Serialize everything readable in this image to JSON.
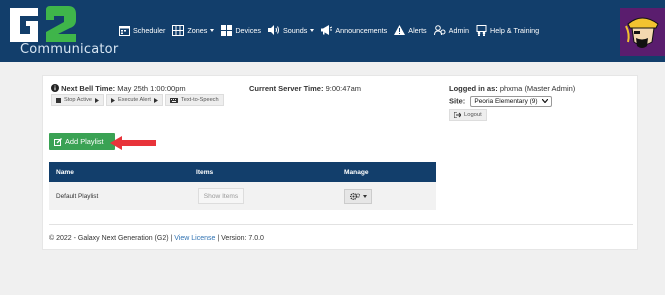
{
  "brand": {
    "logo_text": "G2",
    "subtitle": "Communicator"
  },
  "nav": {
    "items": [
      {
        "label": "Scheduler",
        "icon": "calendar-icon",
        "dropdown": false
      },
      {
        "label": "Zones",
        "icon": "zones-grid-icon",
        "dropdown": true
      },
      {
        "label": "Devices",
        "icon": "devices-grid-icon",
        "dropdown": false
      },
      {
        "label": "Sounds",
        "icon": "speaker-icon",
        "dropdown": true
      },
      {
        "label": "Announcements",
        "icon": "megaphone-icon",
        "dropdown": false
      },
      {
        "label": "Alerts",
        "icon": "warning-icon",
        "dropdown": false
      },
      {
        "label": "Admin",
        "icon": "admin-users-icon",
        "dropdown": false
      },
      {
        "label": "Help & Training",
        "icon": "help-training-icon",
        "dropdown": false
      }
    ]
  },
  "status": {
    "next_bell_label": "Next Bell Time:",
    "next_bell_value": "May 25th 1:00:00pm",
    "server_time_label": "Current Server Time:",
    "server_time_value": "9:00:47am",
    "logged_in_label": "Logged in as:",
    "logged_in_value": "phxma (Master Admin)",
    "site_label": "Site:",
    "site_value": "Peoria Elementary (9)"
  },
  "actions": {
    "stop_active": "Stop Active",
    "execute_alert": "Execute Alert",
    "text_to_speech": "Text-to-Speech",
    "logout": "Logout",
    "add_playlist": "Add Playlist"
  },
  "table": {
    "headers": [
      "Name",
      "Items",
      "Manage"
    ],
    "rows": [
      {
        "name": "Default Playlist",
        "items_button": "Show Items"
      }
    ]
  },
  "footer": {
    "copyright": "© 2022 - Galaxy Next Generation (G2)",
    "separator1": "|",
    "license_link": "View License",
    "separator2": "|",
    "version": "Version: 7.0.0"
  },
  "colors": {
    "navbar": "#123e6b",
    "add_button": "#3aa254",
    "arrow": "#e8333a",
    "link": "#2f72b2"
  }
}
